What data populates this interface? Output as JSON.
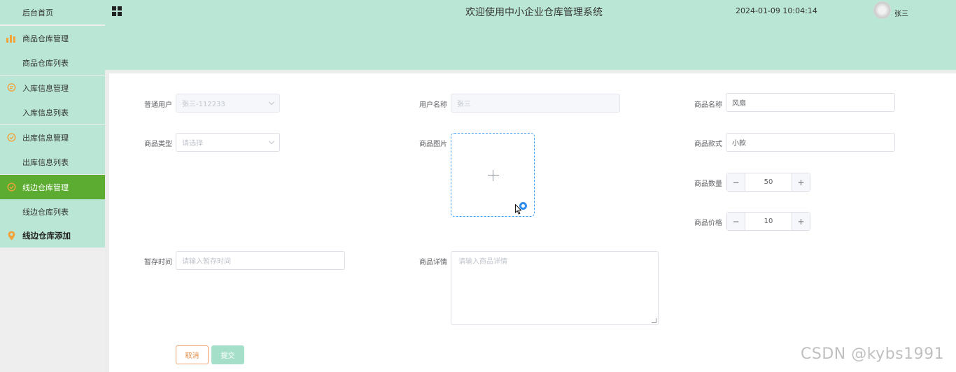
{
  "sidebar": {
    "items": [
      {
        "label": "后台首页",
        "icon": ""
      },
      {
        "label": "商品仓库管理",
        "icon": "bar-chart-icon",
        "icon_color": "#f2a33a"
      },
      {
        "label": "商品仓库列表",
        "icon": ""
      },
      {
        "label": "入库信息管理",
        "icon": "chat-icon",
        "icon_color": "#f2a33a"
      },
      {
        "label": "入库信息列表",
        "icon": ""
      },
      {
        "label": "出库信息管理",
        "icon": "check-circle-icon",
        "icon_color": "#f2a33a"
      },
      {
        "label": "出库信息列表",
        "icon": ""
      },
      {
        "label": "线边仓库管理",
        "icon": "check-circle-icon",
        "icon_color": "#f2a33a",
        "active": true
      },
      {
        "label": "线边仓库列表",
        "icon": ""
      },
      {
        "label": "线边仓库添加",
        "icon": "location-pin-icon",
        "icon_color": "#f2a33a"
      }
    ]
  },
  "header": {
    "title": "欢迎使用中小企业仓库管理系统",
    "datetime": "2024-01-09 10:04:14",
    "username": "张三"
  },
  "form": {
    "user_type_label": "普通用户",
    "user_type_value": "张三-112233",
    "user_name_label": "用户名称",
    "user_name_value": "张三",
    "product_name_label": "商品名称",
    "product_name_value": "风扇",
    "product_type_label": "商品类型",
    "product_type_placeholder": "请选择",
    "product_image_label": "商品图片",
    "product_style_label": "商品款式",
    "product_style_value": "小款",
    "product_qty_label": "商品数量",
    "product_qty_value": "50",
    "product_price_label": "商品价格",
    "product_price_value": "10",
    "stepper_minus": "−",
    "stepper_plus": "+",
    "temp_time_label": "暂存时间",
    "temp_time_placeholder": "请输入暂存时间",
    "detail_label": "商品详情",
    "detail_placeholder": "请输入商品详情",
    "cancel_label": "取消",
    "submit_label": "提交"
  },
  "colors": {
    "header_bg": "#bae6d5",
    "sidebar_active": "#5bac30",
    "upload_border": "#409eff",
    "cancel_border": "#f0a36a",
    "submit_bg": "#a6dfc9"
  },
  "watermark": "CSDN @kybs1991"
}
